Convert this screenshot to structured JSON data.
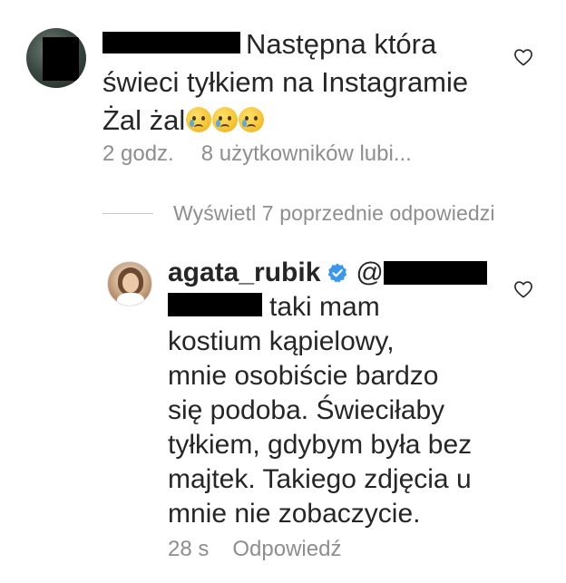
{
  "comment1": {
    "username_redacted": "",
    "text_line1": "Następna która",
    "text_line2": "świeci tyłkiem na Instagramie",
    "text_line3": "Żal żal",
    "emojis": [
      "crying-face",
      "crying-face",
      "crying-face"
    ],
    "time": "2 godz.",
    "likes": "8 użytkowników lubi..."
  },
  "view_replies": "Wyświetl 7 poprzednie odpowiedzi",
  "reply": {
    "username": "agata_rubik",
    "mention_prefix": "@",
    "text_lines": [
      "taki mam",
      "kostium kąpielowy,",
      "mnie osobiście bardzo",
      "się podoba. Świeciłaby",
      "tyłkiem, gdybym była bez",
      "majtek. Takiego zdjęcia u",
      "mnie nie zobaczycie."
    ],
    "time": "28 s",
    "reply_label": "Odpowiedź"
  },
  "colors": {
    "text": "#262626",
    "meta": "#8e8e8e",
    "verified": "#3897f0"
  }
}
